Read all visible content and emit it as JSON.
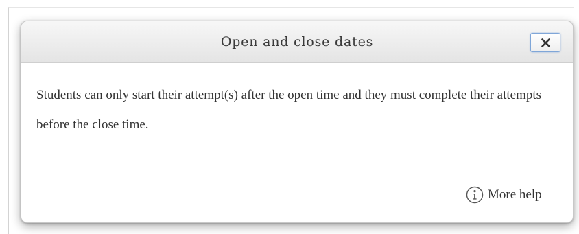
{
  "dialog": {
    "title": "Open and close dates",
    "close_icon": "close-icon",
    "body_text": "Students can only start their attempt(s) after the open time and they must complete their attempts before the close time.",
    "more_help_label": "More help",
    "more_help_icon": "info-icon"
  }
}
